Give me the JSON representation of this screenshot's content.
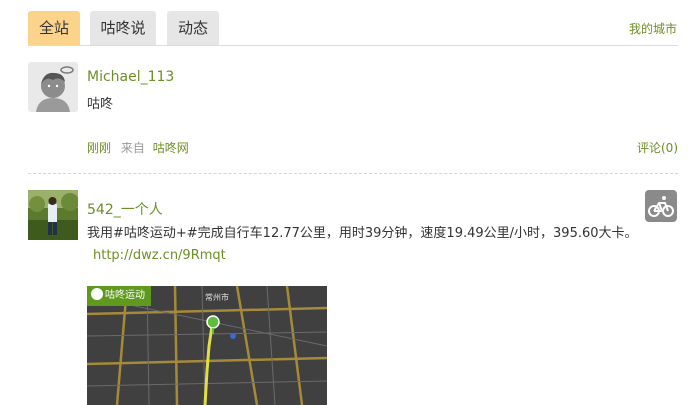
{
  "tabs": {
    "items": [
      {
        "label": "全站",
        "active": true
      },
      {
        "label": "咕咚说",
        "active": false
      },
      {
        "label": "动态",
        "active": false
      }
    ],
    "city_link": "我的城市"
  },
  "posts": [
    {
      "username": "Michael_113",
      "content": "咕咚",
      "time": "刚刚",
      "from_label": "来自",
      "source": "咕咚网",
      "comment": "评论(0)"
    },
    {
      "username": "542_一个人",
      "content": "我用#咕咚运动+#完成自行车12.77公里，用时39分钟，速度19.49公里/小时，395.60大卡。",
      "link": "http://dwz.cn/9Rmqt",
      "badge": "bike-icon",
      "map": {
        "badge_label": "咕咚运动",
        "city_label": "常州市"
      }
    }
  ],
  "colors": {
    "accent": "#6d8f25",
    "active_tab": "#fbd38a",
    "tab_bg": "#e6e6e6",
    "muted": "#999999"
  }
}
